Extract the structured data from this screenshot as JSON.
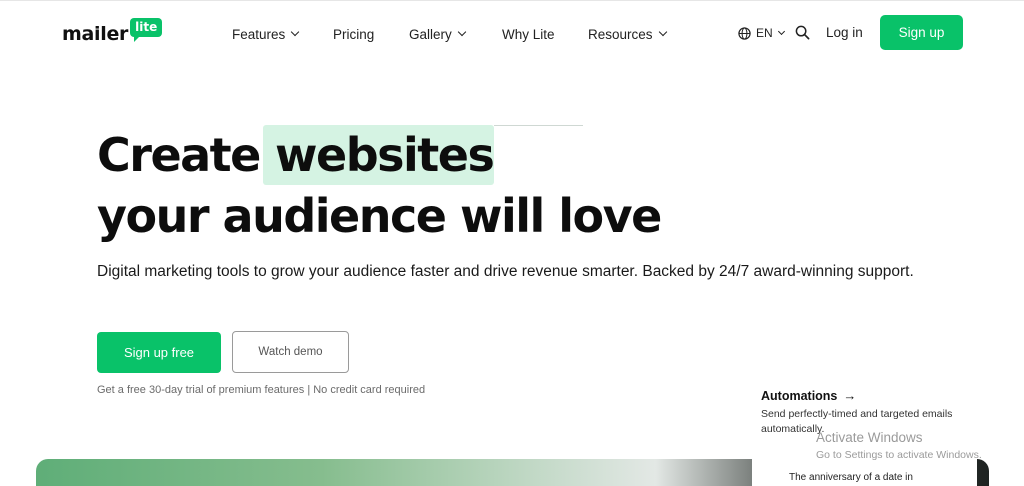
{
  "header": {
    "logo": {
      "word": "mailer",
      "badge": "lite"
    },
    "nav": [
      {
        "label": "Features",
        "has_menu": true
      },
      {
        "label": "Pricing",
        "has_menu": false
      },
      {
        "label": "Gallery",
        "has_menu": true
      },
      {
        "label": "Why Lite",
        "has_menu": false
      },
      {
        "label": "Resources",
        "has_menu": true
      }
    ],
    "language": "EN",
    "login_label": "Log in",
    "signup_label": "Sign up",
    "brand_color": "#09c269"
  },
  "hero": {
    "title_line1_a": "Create",
    "title_line1_b": "websites",
    "title_line2": "your audience will love",
    "subtitle": "Digital marketing tools to grow your audience faster and drive revenue smarter. Backed by 24/7 award-winning support.",
    "primary_cta": "Sign up free",
    "secondary_cta": "Watch demo",
    "note": "Get a free 30-day trial of premium features | No credit card required"
  },
  "feature": {
    "title": "Automations",
    "arrow": "→",
    "description": "Send perfectly-timed and targeted emails automatically."
  },
  "preview_card": {
    "text": "The anniversary of a date in"
  },
  "watermark": {
    "line1": "Activate Windows",
    "line2": "Go to Settings to activate Windows."
  }
}
